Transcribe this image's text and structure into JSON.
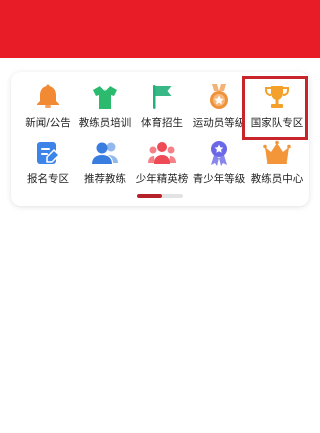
{
  "colors": {
    "top_bar": "#e81c26",
    "highlight": "#c8242c",
    "pager_active": "#b5222a",
    "pager_track": "#e3e3e3"
  },
  "menu": {
    "rows": [
      [
        {
          "key": "news",
          "label": "新闻/公告",
          "icon": "bell-icon",
          "color": "#f28a34"
        },
        {
          "key": "coach-training",
          "label": "教练员培训",
          "icon": "shirt-icon",
          "color": "#2cbb6e"
        },
        {
          "key": "sports-admission",
          "label": "体育招生",
          "icon": "flag-icon",
          "color": "#23b07a"
        },
        {
          "key": "athlete-level",
          "label": "运动员等级",
          "icon": "medal-icon",
          "color": "#f0923a"
        },
        {
          "key": "national-team",
          "label": "国家队专区",
          "icon": "trophy-icon",
          "color": "#f3a12a"
        }
      ],
      [
        {
          "key": "registration",
          "label": "报名专区",
          "icon": "edit-form-icon",
          "color": "#3d84e8"
        },
        {
          "key": "recommend-coach",
          "label": "推荐教练",
          "icon": "people-icon",
          "color": "#3a7de0"
        },
        {
          "key": "youth-ranking",
          "label": "少年精英榜",
          "icon": "group-icon",
          "color": "#ef4b56"
        },
        {
          "key": "youth-level",
          "label": "青少年等级",
          "icon": "ribbon-medal-icon",
          "color": "#6a68e6"
        },
        {
          "key": "coach-center",
          "label": "教练员中心",
          "icon": "crown-icon",
          "color": "#f3963a"
        }
      ]
    ],
    "highlighted_key": "national-team"
  },
  "pager": {
    "pages": 2,
    "current": 1,
    "progress": 0.55
  }
}
